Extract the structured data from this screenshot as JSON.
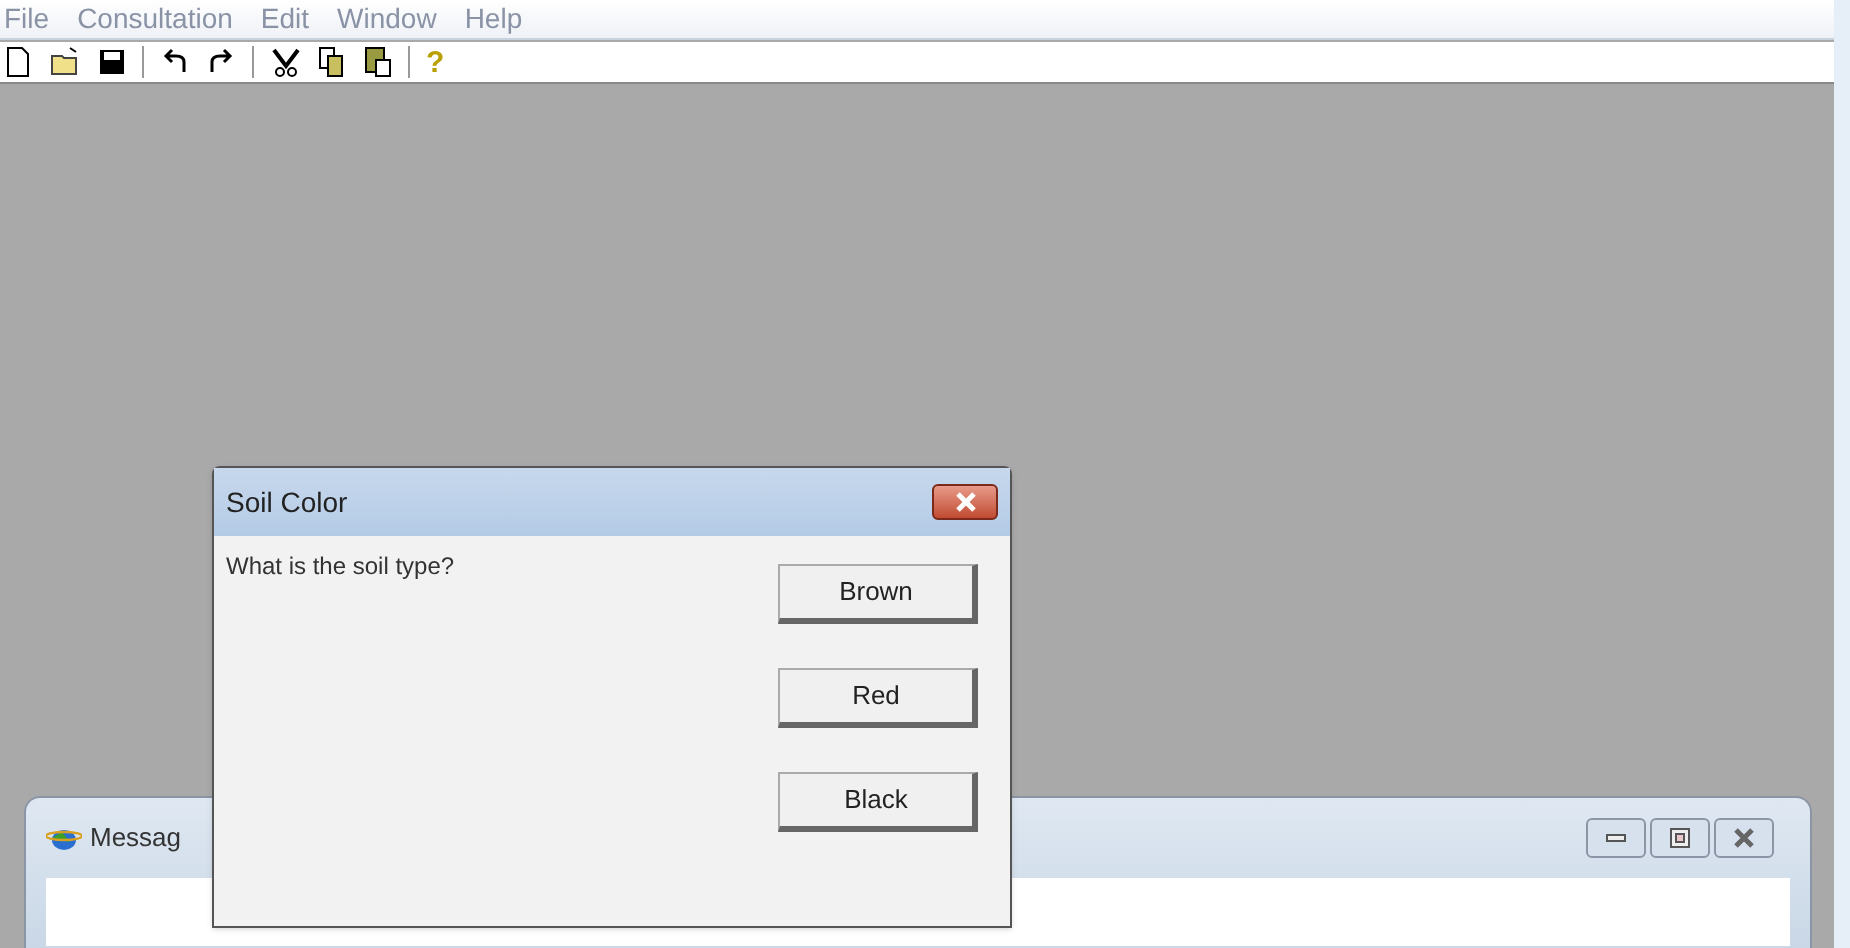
{
  "menu": [
    "File",
    "Consultation",
    "Edit",
    "Window",
    "Help"
  ],
  "toolbar": [
    {
      "kind": "new"
    },
    {
      "kind": "open"
    },
    {
      "kind": "save"
    },
    {
      "kind": "sep"
    },
    {
      "kind": "undo"
    },
    {
      "kind": "redo"
    },
    {
      "kind": "sep"
    },
    {
      "kind": "cut"
    },
    {
      "kind": "copy"
    },
    {
      "kind": "paste"
    },
    {
      "kind": "sep"
    },
    {
      "kind": "help",
      "label": "?"
    }
  ],
  "message_window": {
    "title": "Messag"
  },
  "dialog": {
    "title": "Soil Color",
    "question": "What is the soil type?",
    "buttons": [
      "Brown",
      "Red",
      "Black"
    ]
  }
}
